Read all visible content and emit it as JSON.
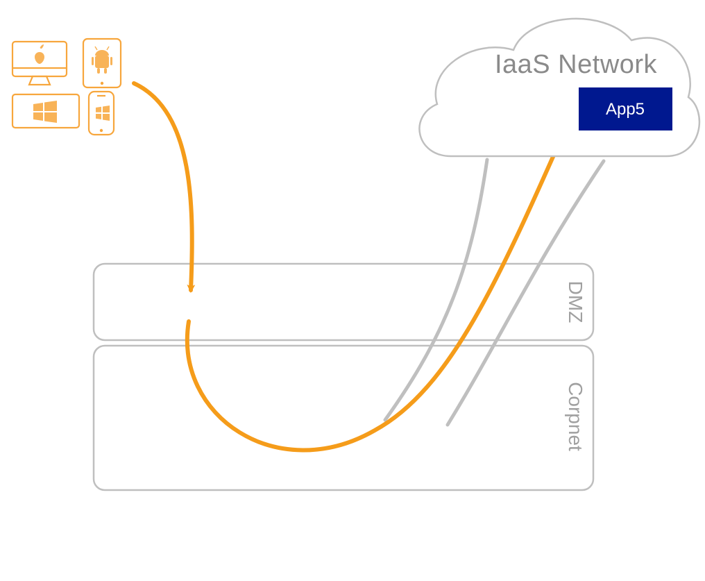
{
  "cloud": {
    "title": "IaaS  Network",
    "app_label": "App5"
  },
  "zones": {
    "dmz_label": "DMZ",
    "corpnet_label": "Corpnet"
  },
  "colors": {
    "orange": "#f59c1a",
    "orange_light": "#f7a63c",
    "gray_stroke": "#bfbfbf",
    "gray_text": "#8a8a8a",
    "zone_text": "#a0a0a0",
    "app_blue": "#00188f",
    "white": "#ffffff"
  }
}
